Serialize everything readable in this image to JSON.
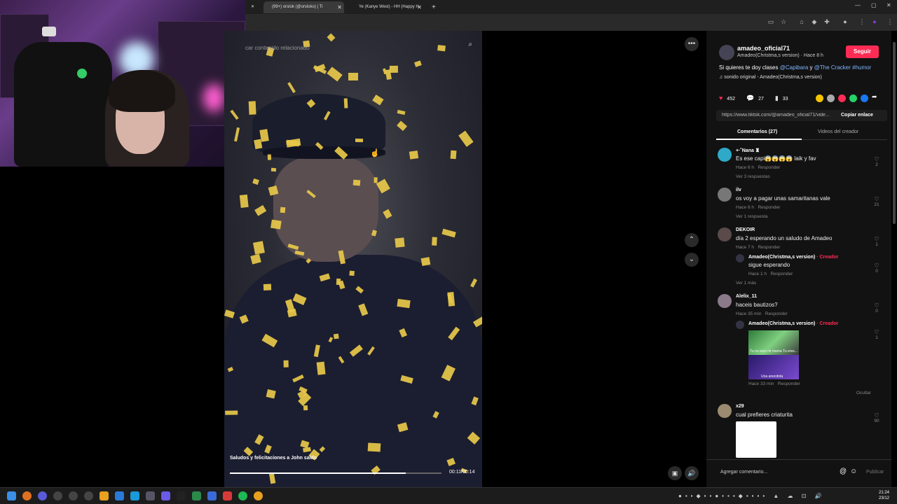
{
  "browser": {
    "tabs": [
      {
        "label": "(99+) orslok (@orsloko) | Ti",
        "active": true
      },
      {
        "label": "Ye (Kanye West) - HH (Happy H",
        "active": false
      }
    ],
    "new_tab": "+"
  },
  "video": {
    "search_placeholder": "car contenido relacionado",
    "caption": "Saludos y felicitaciones a John saldo",
    "time": "00:11/00:14",
    "progress": 0.83
  },
  "post": {
    "username": "amadeo_oficial71",
    "subtitle": "Amadeo(Christma,s version) · Hace 8 h",
    "follow_label": "Seguir",
    "description_prefix": "Si quieres te doy clases ",
    "mention1": "@Capibara",
    "and": " y ",
    "mention2": "@The Cracker",
    "hashtag": " #humor",
    "sound": "sonido original - Amadeo(Christma,s version)",
    "likes": "452",
    "comments": "27",
    "saves": "33",
    "url": "https://www.tiktok.com/@amadeo_oficial71/vide...",
    "copy_link": "Copiar enlace",
    "tab_comments": "Comentarios (27)",
    "tab_creator": "Videos del creador"
  },
  "comments": [
    {
      "user": "+·˚Nana ♜",
      "text": "Es ese capi😱😱😱😱 laik y fav",
      "time": "Hace 6 h",
      "reply": "Responder",
      "likes": "2",
      "more": "Ver 3 respuestas"
    },
    {
      "user": "ilv",
      "text": "os voy a pagar unas samaritanas vale",
      "time": "Hace 6 h",
      "reply": "Responder",
      "likes": "21",
      "more": "Ver 1 respuesta"
    },
    {
      "user": "DEKOIR",
      "text": "día 2 esperando un saludo de Amadeo",
      "time": "Hace 7 h",
      "reply": "Responder",
      "likes": "1",
      "sub_user": "Amadeo(Christma,s version)",
      "sub_tag": "· Creador",
      "sub_text": "sigue esperando",
      "sub_time": "Hace 1 h",
      "sub_reply": "Responder",
      "sub_likes": "0",
      "more": "Ver 1 más"
    },
    {
      "user": "Alelix_11",
      "text": "haceis bautizos?",
      "time": "Hace 35 min",
      "reply": "Responder",
      "likes": "0",
      "sub_user": "Amadeo(Christma,s version)",
      "sub_tag": "· Creador",
      "sub_time": "Hace 33 min",
      "sub_reply": "Responder",
      "sub_likes": "1",
      "img_text1": "Tu no eres mi mama Tu eres...",
      "img_text2": "Una anecdota",
      "hide": "Ocultar"
    },
    {
      "user": "x29",
      "text": "cual prefieres criaturita",
      "likes": "90"
    }
  ],
  "composer": {
    "placeholder": "Agregar comentario...",
    "publish": "Publicar"
  },
  "taskbar": {
    "time": "21:24",
    "date": "23/12"
  }
}
